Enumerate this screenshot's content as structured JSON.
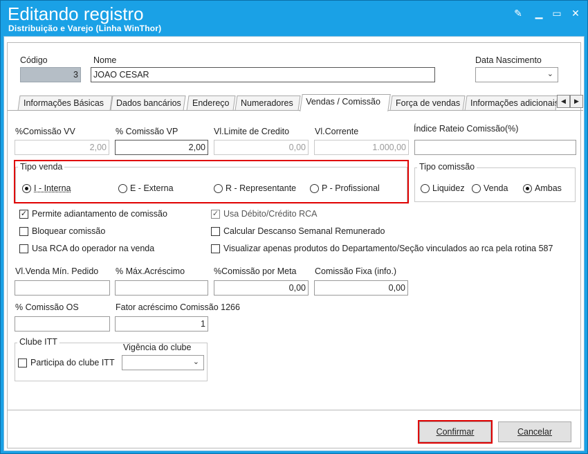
{
  "window": {
    "title": "Editando registro",
    "subtitle": "Distribuição e Varejo (Linha WinThor)",
    "controls": {
      "pin": "✎",
      "minimize": "▁",
      "maximize": "▭",
      "close": "✕"
    }
  },
  "header": {
    "codigo_label": "Código",
    "codigo_value": "3",
    "nome_label": "Nome",
    "nome_value": "JOAO CESAR",
    "data_nascimento_label": "Data Nascimento",
    "data_nascimento_value": ""
  },
  "tabs": [
    {
      "label": "Informações Básicas"
    },
    {
      "label": "Dados bancários"
    },
    {
      "label": "Endereço"
    },
    {
      "label": "Numeradores"
    },
    {
      "label": "Vendas  / Comissão"
    },
    {
      "label": "Força de vendas"
    },
    {
      "label": "Informações adicionais"
    }
  ],
  "active_tab": "Vendas  / Comissão",
  "fields_row1": {
    "comissao_vv_label": "%Comissão VV",
    "comissao_vv_value": "2,00",
    "comissao_vp_label": "% Comissão VP",
    "comissao_vp_value": "2,00",
    "limite_credito_label": "Vl.Limite de Credito",
    "limite_credito_value": "0,00",
    "vl_corrente_label": "Vl.Corrente",
    "vl_corrente_value": "1.000,00",
    "indice_rateio_label": "Índice Rateio Comissão(%)",
    "indice_rateio_value": ""
  },
  "tipo_venda": {
    "label": "Tipo venda",
    "options": [
      "I - Interna",
      "E - Externa",
      "R - Representante",
      "P - Profissional"
    ],
    "selected": "I - Interna"
  },
  "tipo_comissao": {
    "label": "Tipo comissão",
    "options": [
      "Liquidez",
      "Venda",
      "Ambas"
    ],
    "selected": "Ambas"
  },
  "checkboxes": {
    "permite_adiantamento": {
      "label": "Permite adiantamento de comissão",
      "checked": true
    },
    "usa_debito_credito": {
      "label": "Usa Débito/Crédito RCA",
      "checked": true
    },
    "bloquear_comissao": {
      "label": "Bloquear comissão",
      "checked": false
    },
    "calcular_dsr": {
      "label": "Calcular Descanso Semanal Remunerado",
      "checked": false
    },
    "usa_rca_operador": {
      "label": "Usa RCA do operador na venda",
      "checked": false
    },
    "visualizar_produtos": {
      "label": "Visualizar apenas produtos do Departamento/Seção vinculados ao rca pela rotina 587",
      "checked": false
    }
  },
  "fields_row2": {
    "venda_min_label": "Vl.Venda Mín. Pedido",
    "venda_min_value": "",
    "max_acrescimo_label": "% Máx.Acréscimo",
    "max_acrescimo_value": "",
    "comissao_meta_label": "%Comissão por Meta",
    "comissao_meta_value": "0,00",
    "comissao_fixa_label": "Comissão Fixa (info.)",
    "comissao_fixa_value": "0,00"
  },
  "fields_row3": {
    "comissao_os_label": "% Comissão OS",
    "comissao_os_value": "",
    "fator_acrescimo_label": "Fator acréscimo Comissão 1266",
    "fator_acrescimo_value": "1"
  },
  "clube_itt": {
    "label": "Clube ITT",
    "participa_label": "Participa do clube ITT",
    "vigencia_label": "Vigência do clube",
    "vigencia_value": ""
  },
  "buttons": {
    "confirmar": "Confirmar",
    "cancelar": "Cancelar"
  },
  "highlight_color": "#e00000",
  "titlebar_color": "#1aa1e6"
}
